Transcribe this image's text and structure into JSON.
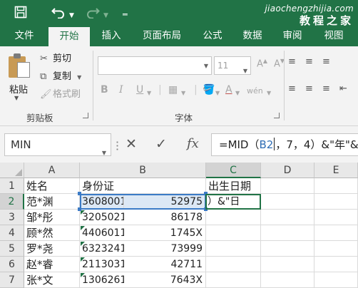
{
  "titlebar": {
    "save_icon": "save-icon",
    "undo_icon": "undo-icon",
    "redo_icon": "redo-icon",
    "watermark_url": "jiaochengzhijia.com",
    "watermark_text": "教程之家"
  },
  "tabs": [
    "文件",
    "开始",
    "插入",
    "页面布局",
    "公式",
    "数据",
    "审阅",
    "视图"
  ],
  "active_tab": "开始",
  "ribbon": {
    "clipboard": {
      "paste": "粘贴",
      "cut": "剪切",
      "copy": "复制",
      "format_painter": "格式刷",
      "group_label": "剪贴板"
    },
    "font": {
      "font_name": "",
      "font_size": "11",
      "bold": "B",
      "italic": "I",
      "underline": "U",
      "group_label": "字体"
    }
  },
  "formula_bar": {
    "name_box": "MIN",
    "cancel_icon": "✕",
    "enter_icon": "✓",
    "fx_label": "fx",
    "formula_prefix": "=MID（",
    "formula_ref": "B2",
    "formula_suffix": "，7，4）&\"年\"&"
  },
  "columns": [
    {
      "label": "A"
    },
    {
      "label": "B"
    },
    {
      "label": "C"
    },
    {
      "label": "D"
    },
    {
      "label": "E"
    }
  ],
  "rows": [
    {
      "num": "1",
      "a": "姓名",
      "b1": "身份证",
      "b2": "",
      "c": "出生日期"
    },
    {
      "num": "2",
      "a": "范*渊",
      "b1": "3608001",
      "b2": "52975",
      "c": "）&\"日"
    },
    {
      "num": "3",
      "a": "邹*彤",
      "b1": "3205021",
      "b2": "86178",
      "c": ""
    },
    {
      "num": "4",
      "a": "顾*然",
      "b1": "4406011",
      "b2": "1745X",
      "c": ""
    },
    {
      "num": "5",
      "a": "罗*尧",
      "b1": "6323241",
      "b2": "73999",
      "c": ""
    },
    {
      "num": "6",
      "a": "赵*睿",
      "b1": "2113031",
      "b2": "42711",
      "c": ""
    },
    {
      "num": "7",
      "a": "张*文",
      "b1": "1306261",
      "b2": "7643X",
      "c": ""
    }
  ]
}
